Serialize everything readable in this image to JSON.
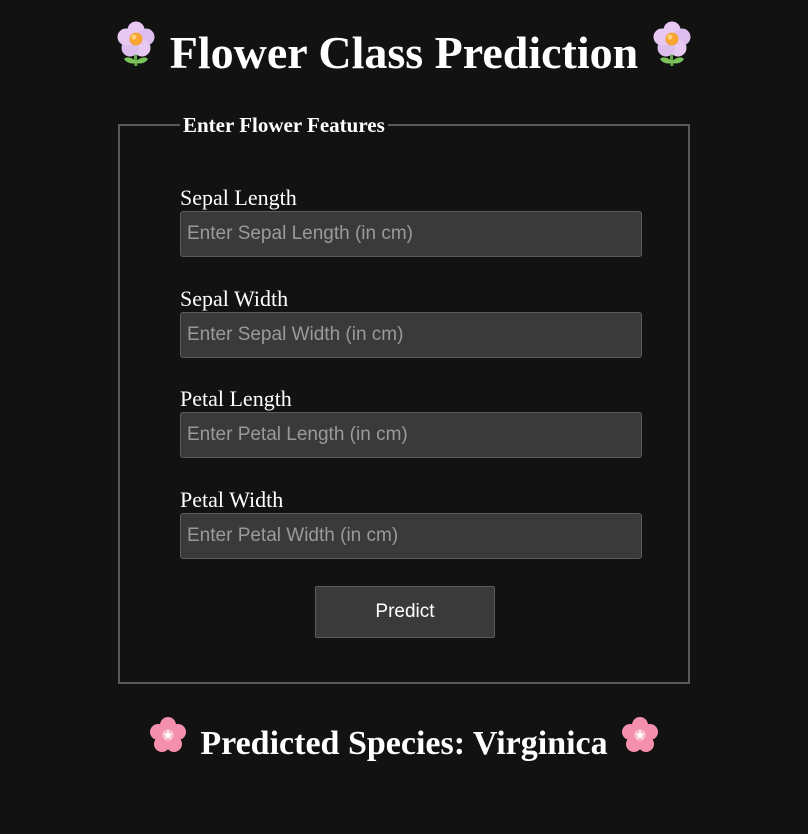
{
  "page": {
    "title": "Flower Class Prediction",
    "title_icon": "flower-icon",
    "accent_text_color": "#ffffff",
    "background_color": "#121212"
  },
  "form": {
    "legend": "Enter Flower Features",
    "fields": [
      {
        "label": "Sepal Length",
        "placeholder": "Enter Sepal Length (in cm)",
        "value": ""
      },
      {
        "label": "Sepal Width",
        "placeholder": "Enter Sepal Width (in cm)",
        "value": ""
      },
      {
        "label": "Petal Length",
        "placeholder": "Enter Petal Length (in cm)",
        "value": ""
      },
      {
        "label": "Petal Width",
        "placeholder": "Enter Petal Width (in cm)",
        "value": ""
      }
    ],
    "submit_label": "Predict"
  },
  "result": {
    "text": "Predicted Species: Virginica",
    "icon": "cherry-blossom-icon"
  }
}
